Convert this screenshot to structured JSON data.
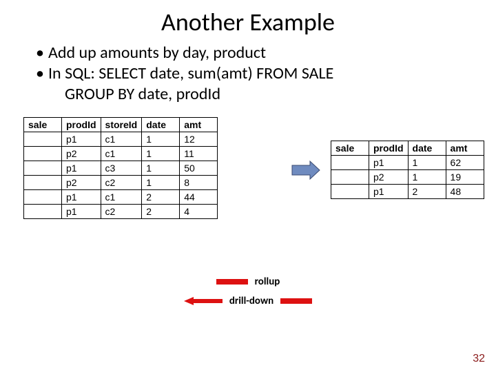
{
  "title": "Another Example",
  "bullets": {
    "b1": "Add up amounts by day, product",
    "b2": "In SQL:  SELECT date, sum(amt) FROM SALE",
    "b2_line2": "GROUP BY date, prodId"
  },
  "left_table": {
    "headers": [
      "sale",
      "prodId",
      "storeId",
      "date",
      "amt"
    ],
    "rows": [
      [
        "",
        "p1",
        "c1",
        "1",
        "12"
      ],
      [
        "",
        "p2",
        "c1",
        "1",
        "11"
      ],
      [
        "",
        "p1",
        "c3",
        "1",
        "50"
      ],
      [
        "",
        "p2",
        "c2",
        "1",
        "8"
      ],
      [
        "",
        "p1",
        "c1",
        "2",
        "44"
      ],
      [
        "",
        "p1",
        "c2",
        "2",
        "4"
      ]
    ]
  },
  "right_table": {
    "headers": [
      "sale",
      "prodId",
      "date",
      "amt"
    ],
    "rows": [
      [
        "",
        "p1",
        "1",
        "62"
      ],
      [
        "",
        "p2",
        "1",
        "19"
      ],
      [
        "",
        "p1",
        "2",
        "48"
      ]
    ]
  },
  "legend": {
    "rollup": "rollup",
    "drilldown": "drill-down"
  },
  "page_number": "32"
}
